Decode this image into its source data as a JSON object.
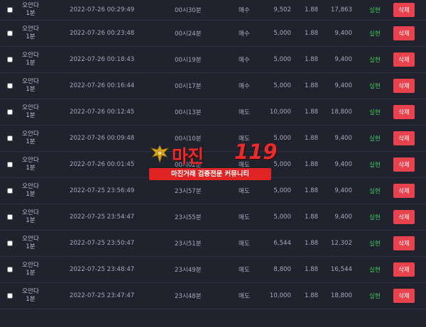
{
  "columns": [
    "game",
    "datetime",
    "round",
    "pick",
    "amount",
    "odds",
    "win",
    "status",
    "action"
  ],
  "rows": [
    {
      "game": "오안다",
      "game_sub": "1분",
      "datetime": "2022-07-26 00:29:49",
      "round": "00시30분",
      "pick": "매수",
      "amount": "9,502",
      "odds": "1.88",
      "win": "17,863",
      "status": "실현",
      "delete_label": "삭제"
    },
    {
      "game": "오안다",
      "game_sub": "1분",
      "datetime": "2022-07-26 00:23:48",
      "round": "00시24분",
      "pick": "매수",
      "amount": "5,000",
      "odds": "1.88",
      "win": "9,400",
      "status": "실현",
      "delete_label": "삭제"
    },
    {
      "game": "오안다",
      "game_sub": "1분",
      "datetime": "2022-07-26 00:18:43",
      "round": "00시19분",
      "pick": "매수",
      "amount": "5,000",
      "odds": "1.88",
      "win": "9,400",
      "status": "실현",
      "delete_label": "삭제"
    },
    {
      "game": "오안다",
      "game_sub": "1분",
      "datetime": "2022-07-26 00:16:44",
      "round": "00시17분",
      "pick": "매수",
      "amount": "5,000",
      "odds": "1.88",
      "win": "9,400",
      "status": "실현",
      "delete_label": "삭제"
    },
    {
      "game": "오안다",
      "game_sub": "1분",
      "datetime": "2022-07-26 00:12:45",
      "round": "00시13분",
      "pick": "매도",
      "amount": "10,000",
      "odds": "1.88",
      "win": "18,800",
      "status": "실현",
      "delete_label": "삭제"
    },
    {
      "game": "오안다",
      "game_sub": "1분",
      "datetime": "2022-07-26 00:09:48",
      "round": "00시10분",
      "pick": "매도",
      "amount": "5,000",
      "odds": "1.88",
      "win": "9,400",
      "status": "실현",
      "delete_label": "삭제"
    },
    {
      "game": "오안다",
      "game_sub": "1분",
      "datetime": "2022-07-26 00:01:45",
      "round": "00시02분",
      "pick": "매도",
      "amount": "5,000",
      "odds": "1.88",
      "win": "9,400",
      "status": "실현",
      "delete_label": "삭제"
    },
    {
      "game": "오안다",
      "game_sub": "1분",
      "datetime": "2022-07-25 23:56:49",
      "round": "23시57분",
      "pick": "매도",
      "amount": "5,000",
      "odds": "1.88",
      "win": "9,400",
      "status": "실현",
      "delete_label": "삭제"
    },
    {
      "game": "오안다",
      "game_sub": "1분",
      "datetime": "2022-07-25 23:54:47",
      "round": "23시55분",
      "pick": "매도",
      "amount": "5,000",
      "odds": "1.88",
      "win": "9,400",
      "status": "실현",
      "delete_label": "삭제"
    },
    {
      "game": "오안다",
      "game_sub": "1분",
      "datetime": "2022-07-25 23:50:47",
      "round": "23시51분",
      "pick": "매도",
      "amount": "6,544",
      "odds": "1.88",
      "win": "12,302",
      "status": "실현",
      "delete_label": "삭제"
    },
    {
      "game": "오안다",
      "game_sub": "1분",
      "datetime": "2022-07-25 23:48:47",
      "round": "23시49분",
      "pick": "매도",
      "amount": "8,800",
      "odds": "1.88",
      "win": "16,544",
      "status": "실현",
      "delete_label": "삭제"
    },
    {
      "game": "오안다",
      "game_sub": "1분",
      "datetime": "2022-07-25 23:47:47",
      "round": "23시48분",
      "pick": "매도",
      "amount": "10,000",
      "odds": "1.88",
      "win": "18,800",
      "status": "실현",
      "delete_label": "삭제"
    }
  ],
  "watermark": {
    "brand": "마진",
    "brand_num": "119",
    "tagline": "마진거래 검증전문 커뮤니티"
  },
  "colors": {
    "background": "#20232e",
    "status_green": "#3ec75a",
    "delete_red": "#e8424f",
    "watermark_red": "#e82b2b"
  }
}
